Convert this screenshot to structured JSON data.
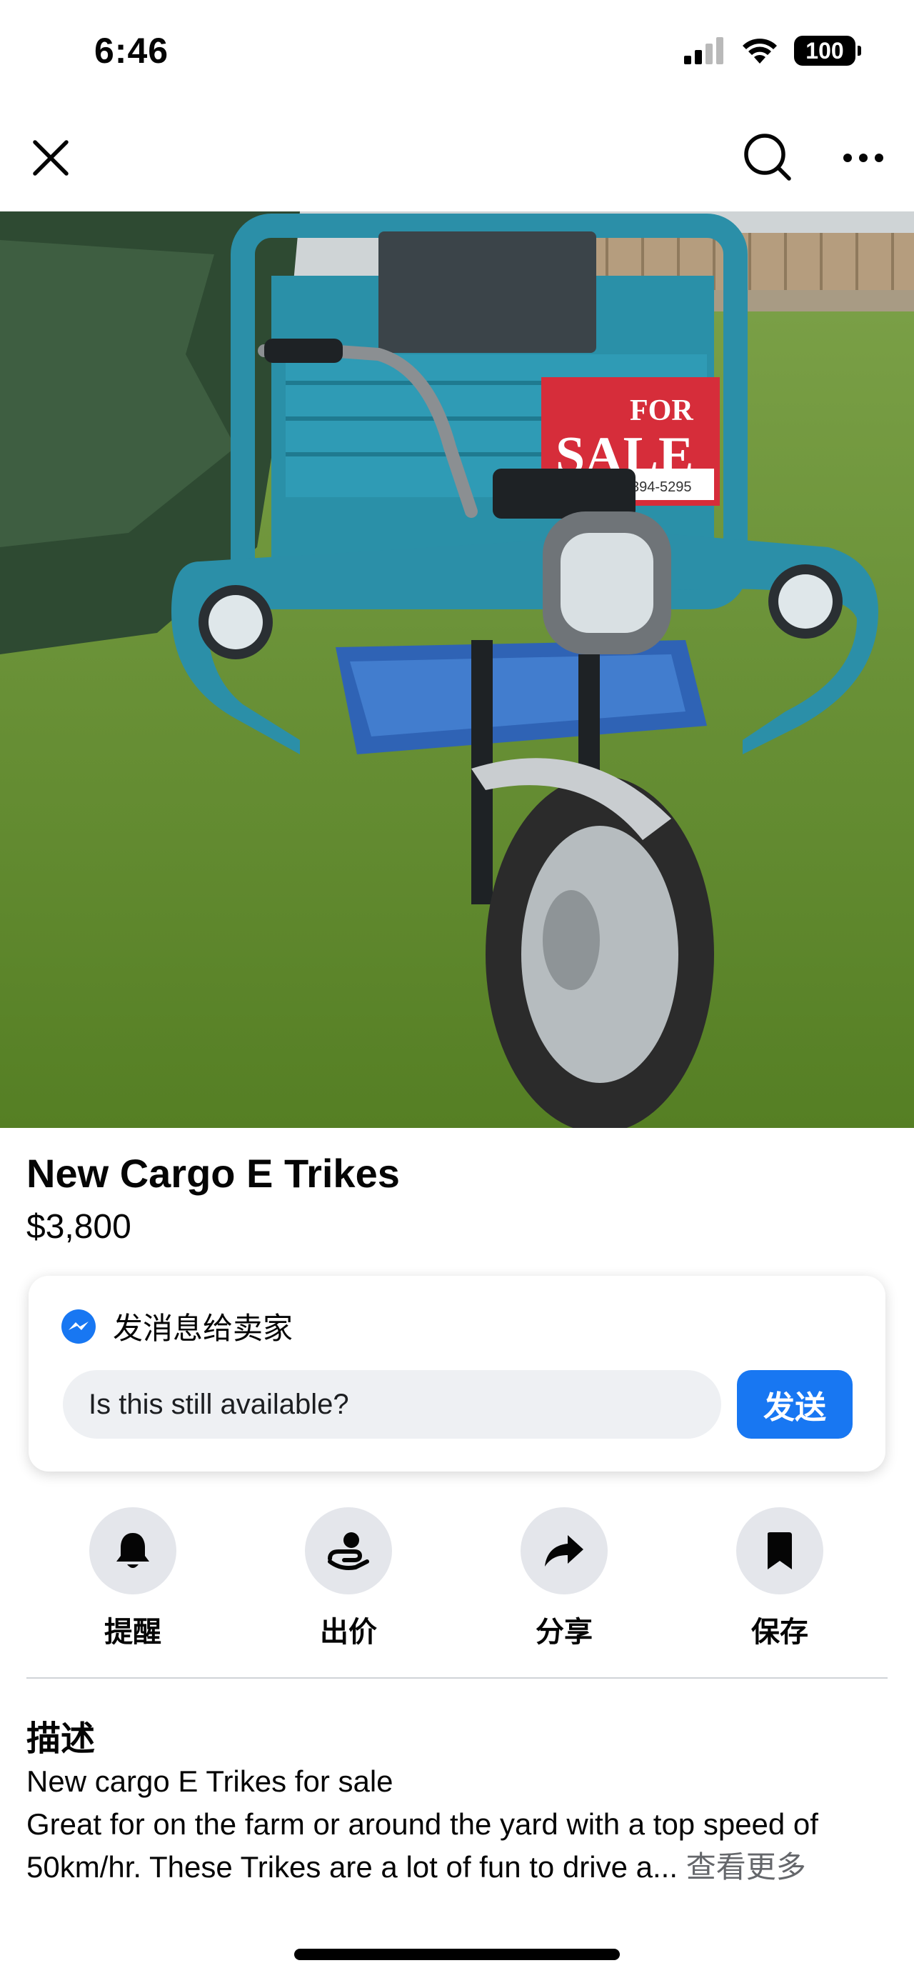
{
  "status_bar": {
    "time": "6:46",
    "battery": "100",
    "icons": [
      "cellular-signal-icon",
      "wifi-icon",
      "battery-icon"
    ]
  },
  "header": {
    "icons": [
      "close-icon",
      "search-icon",
      "more-icon"
    ]
  },
  "photo": {
    "sign_line1": "FOR",
    "sign_line2": "SALE",
    "sign_phone": "394-5295",
    "image_count": 9,
    "active_index": 2
  },
  "listing": {
    "title": "New Cargo E Trikes",
    "price": "$3,800"
  },
  "message": {
    "heading": "发消息给卖家",
    "input_value": "Is this still available?",
    "send_label": "发送",
    "accent": "#1877f2"
  },
  "actions": [
    {
      "label": "提醒",
      "icon": "bell-icon"
    },
    {
      "label": "出价",
      "icon": "offer-icon"
    },
    {
      "label": "分享",
      "icon": "share-icon"
    },
    {
      "label": "保存",
      "icon": "bookmark-icon"
    }
  ],
  "description": {
    "heading": "描述",
    "line1": "New cargo E Trikes for sale",
    "body": "Great for on the farm or around the yard with a top speed of 50km/hr. These Trikes are a lot of fun to drive a...",
    "see_more": "查看更多"
  }
}
